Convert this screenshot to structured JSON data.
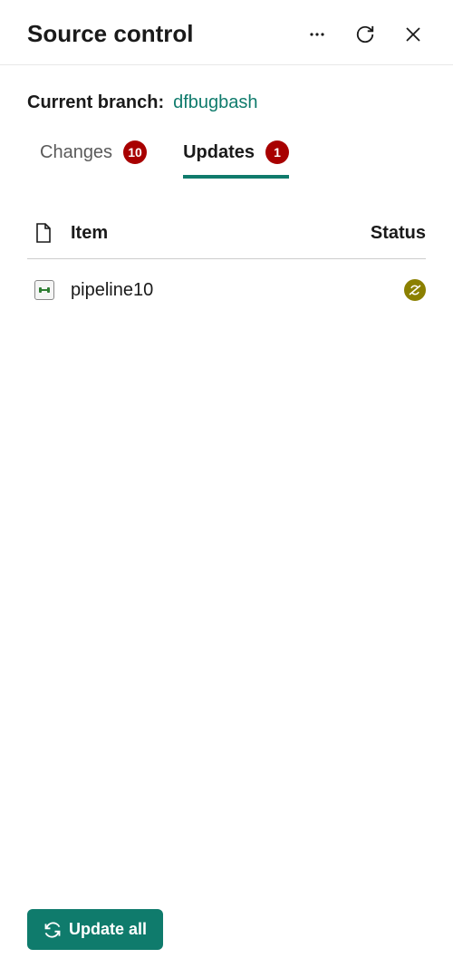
{
  "header": {
    "title": "Source control"
  },
  "branch": {
    "label": "Current branch:",
    "name": "dfbugbash"
  },
  "tabs": {
    "changes": {
      "label": "Changes",
      "count": "10"
    },
    "updates": {
      "label": "Updates",
      "count": "1"
    }
  },
  "table": {
    "headers": {
      "item": "Item",
      "status": "Status"
    },
    "rows": [
      {
        "name": "pipeline10",
        "status": "sync-required"
      }
    ]
  },
  "footer": {
    "update_all_label": "Update all"
  }
}
